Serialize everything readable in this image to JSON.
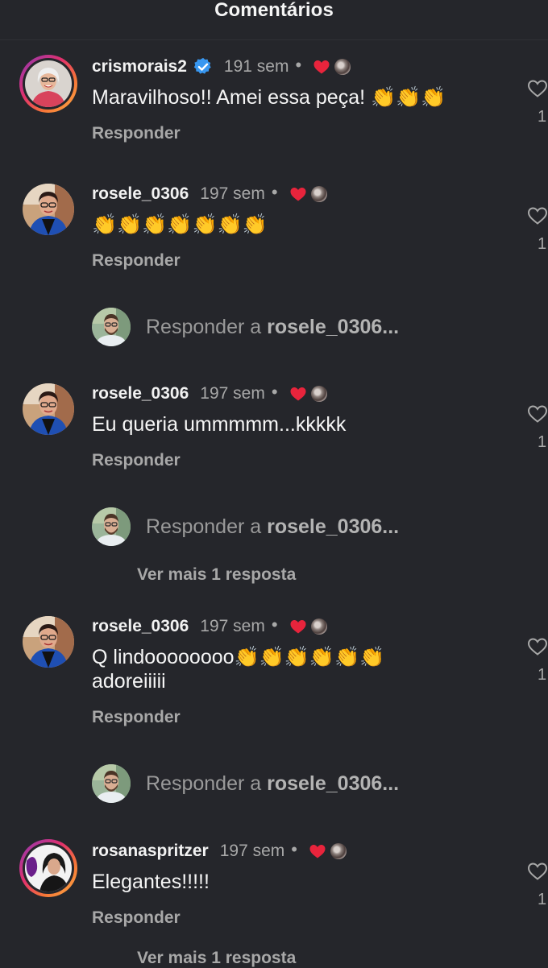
{
  "header": {
    "title": "Comentários"
  },
  "comments": [
    {
      "username": "crismorais2",
      "verified": true,
      "time": "191 sem",
      "dot": "•",
      "text": "Maravilhoso!! Amei essa peça! 👏👏👏",
      "reply_label": "Responder",
      "likes": "1"
    },
    {
      "username": "rosele_0306",
      "verified": false,
      "time": "197 sem",
      "dot": "•",
      "text": "👏👏👏👏👏👏👏",
      "reply_label": "Responder",
      "likes": "1",
      "reply_prompt": {
        "prefix": "Responder a ",
        "target": "rosele_0306..."
      }
    },
    {
      "username": "rosele_0306",
      "verified": false,
      "time": "197 sem",
      "dot": "•",
      "text": "Eu queria ummmmm...kkkkk",
      "reply_label": "Responder",
      "likes": "1",
      "reply_prompt": {
        "prefix": "Responder a ",
        "target": "rosele_0306..."
      },
      "more_replies": "Ver mais 1 resposta"
    },
    {
      "username": "rosele_0306",
      "verified": false,
      "time": "197 sem",
      "dot": "•",
      "text": "Q lindoooooooo👏👏👏👏👏👏\nadoreiiiii",
      "reply_label": "Responder",
      "likes": "1",
      "reply_prompt": {
        "prefix": "Responder a ",
        "target": "rosele_0306..."
      }
    },
    {
      "username": "rosanaspritzer",
      "verified": false,
      "time": "197 sem",
      "dot": "•",
      "text": "Elegantes!!!!!",
      "reply_label": "Responder",
      "likes": "1",
      "more_replies": "Ver mais 1 resposta"
    }
  ],
  "colors": {
    "background": "#25262b",
    "heart_red": "#e8243c",
    "verified_blue": "#3897f0",
    "muted_text": "#a8a8a8"
  }
}
